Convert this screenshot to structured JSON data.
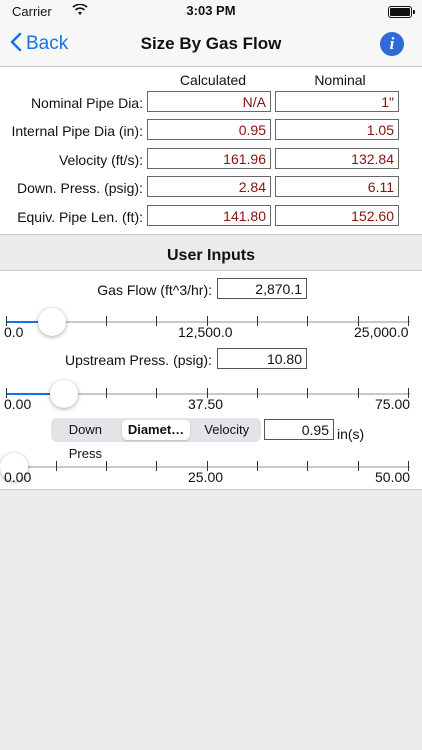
{
  "status": {
    "carrier": "Carrier",
    "time": "3:03 PM"
  },
  "nav": {
    "back_label": "Back",
    "title": "Size By Gas Flow"
  },
  "results": {
    "col_calc": "Calculated",
    "col_nom": "Nominal",
    "rows": [
      {
        "label": "Nominal Pipe Dia:",
        "calc": "N/A",
        "nom": "1\""
      },
      {
        "label": "Internal Pipe Dia (in):",
        "calc": "0.95",
        "nom": "1.05"
      },
      {
        "label": "Velocity (ft/s):",
        "calc": "161.96",
        "nom": "132.84"
      },
      {
        "label": "Down. Press. (psig):",
        "calc": "2.84",
        "nom": "6.11"
      },
      {
        "label": "Equiv. Pipe Len. (ft):",
        "calc": "141.80",
        "nom": "152.60"
      }
    ]
  },
  "user_inputs": {
    "title": "User Inputs",
    "gas_flow": {
      "label": "Gas Flow (ft^3/hr):",
      "value": "2,870.1",
      "min": "0.0",
      "mid": "12,500.0",
      "max": "25,000.0",
      "level": 0.115
    },
    "upstream": {
      "label": "Upstream Press. (psig):",
      "value": "10.80",
      "min": "0.00",
      "mid": "37.50",
      "max": "75.00",
      "level": 0.144
    },
    "mode": {
      "options": [
        "Down Press",
        "Diamet…",
        "Velocity"
      ],
      "selected": "Diamet…"
    },
    "diameter": {
      "value": "0.95",
      "unit": "in(s)",
      "min": "0.00",
      "mid": "25.00",
      "max": "50.00",
      "level": 0.019
    }
  },
  "colors": {
    "accent": "#1673e6",
    "value_text": "#8a1111"
  }
}
